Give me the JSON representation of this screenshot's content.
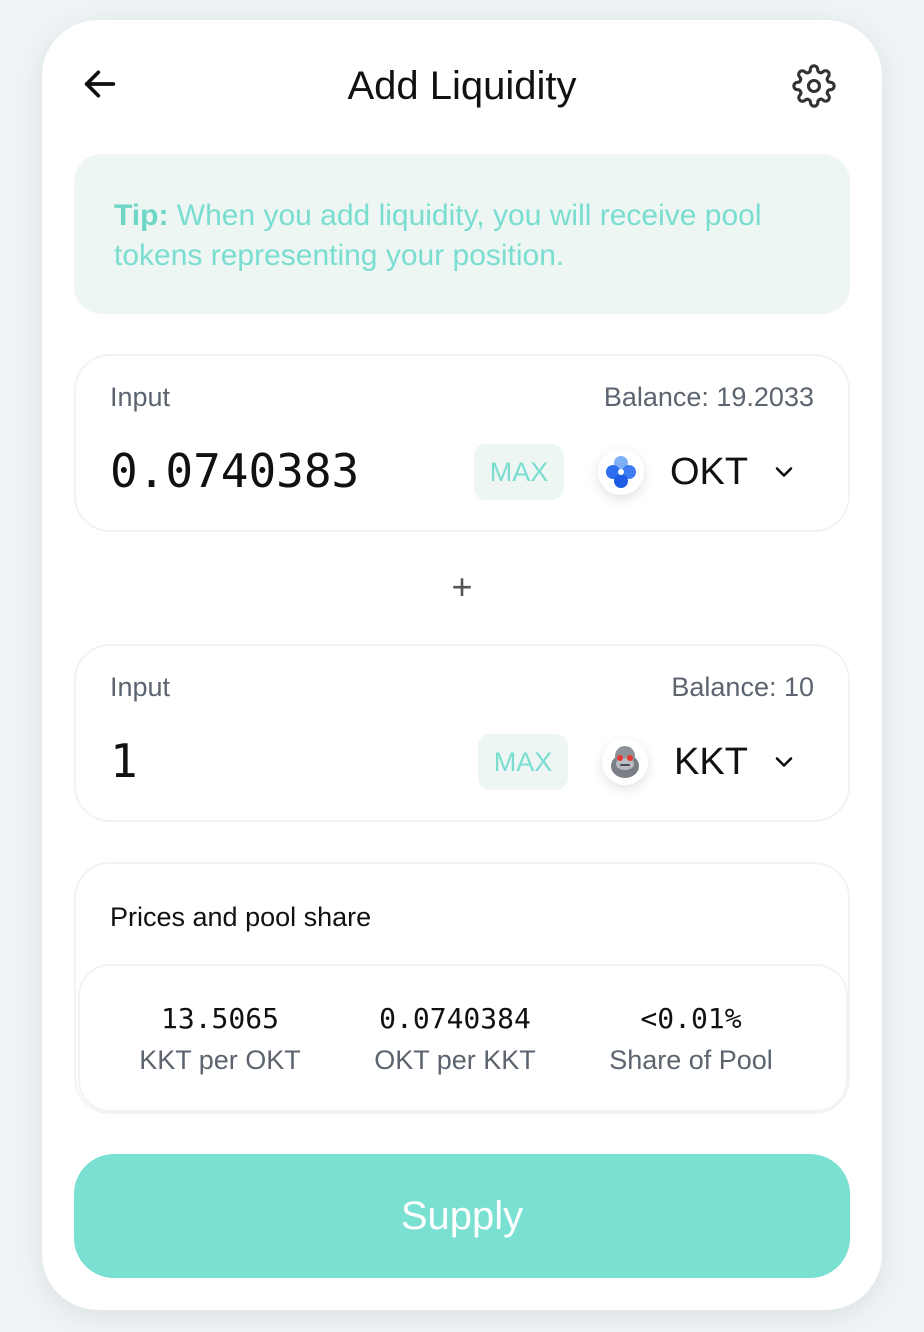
{
  "header": {
    "title": "Add Liquidity",
    "back_icon": "arrow-left-icon",
    "settings_icon": "gear-icon"
  },
  "tip": {
    "label": "Tip:",
    "text": " When you add liquidity, you will receive pool tokens representing your position."
  },
  "input_a": {
    "label": "Input",
    "balance": "Balance: 19.2033",
    "amount": "0.0740383",
    "max_label": "MAX",
    "token": "OKT"
  },
  "input_b": {
    "label": "Input",
    "balance": "Balance: 10",
    "amount": "1",
    "max_label": "MAX",
    "token": "KKT"
  },
  "plus_symbol": "+",
  "prices": {
    "title": "Prices and pool share",
    "items": [
      {
        "value": "13.5065",
        "label": "KKT per OKT"
      },
      {
        "value": "0.0740384",
        "label": "OKT per KKT"
      },
      {
        "value": "<0.01%",
        "label": "Share of Pool"
      }
    ]
  },
  "supply_label": "Supply",
  "colors": {
    "accent": "#79e0d2",
    "tip_background": "#eef6f4",
    "tip_text": "#79ddd0"
  }
}
